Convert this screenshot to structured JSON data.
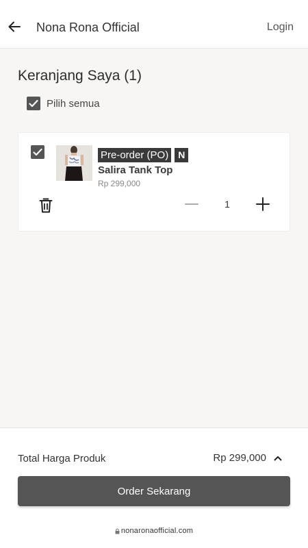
{
  "header": {
    "title": "Nona Rona Official",
    "login_label": "Login"
  },
  "cart": {
    "title": "Keranjang Saya (1)",
    "select_all_label": "Pilih semua",
    "select_all_checked": true
  },
  "items": [
    {
      "checked": true,
      "badge_po": "Pre-order (PO)",
      "badge_new": "N",
      "name": "Salira Tank Top",
      "price": "Rp 299,000",
      "quantity": "1"
    }
  ],
  "footer": {
    "total_label": "Total Harga Produk",
    "total_value": "Rp 299,000",
    "order_button_label": "Order Sekarang"
  },
  "browser": {
    "url": "nonaronaofficial.com"
  },
  "colors": {
    "accent": "#555555",
    "background": "#f7f6f4"
  },
  "icons": [
    "arrow-left-icon",
    "check-icon",
    "trash-icon",
    "minus-icon",
    "plus-icon",
    "chevron-up-icon",
    "lock-icon"
  ]
}
